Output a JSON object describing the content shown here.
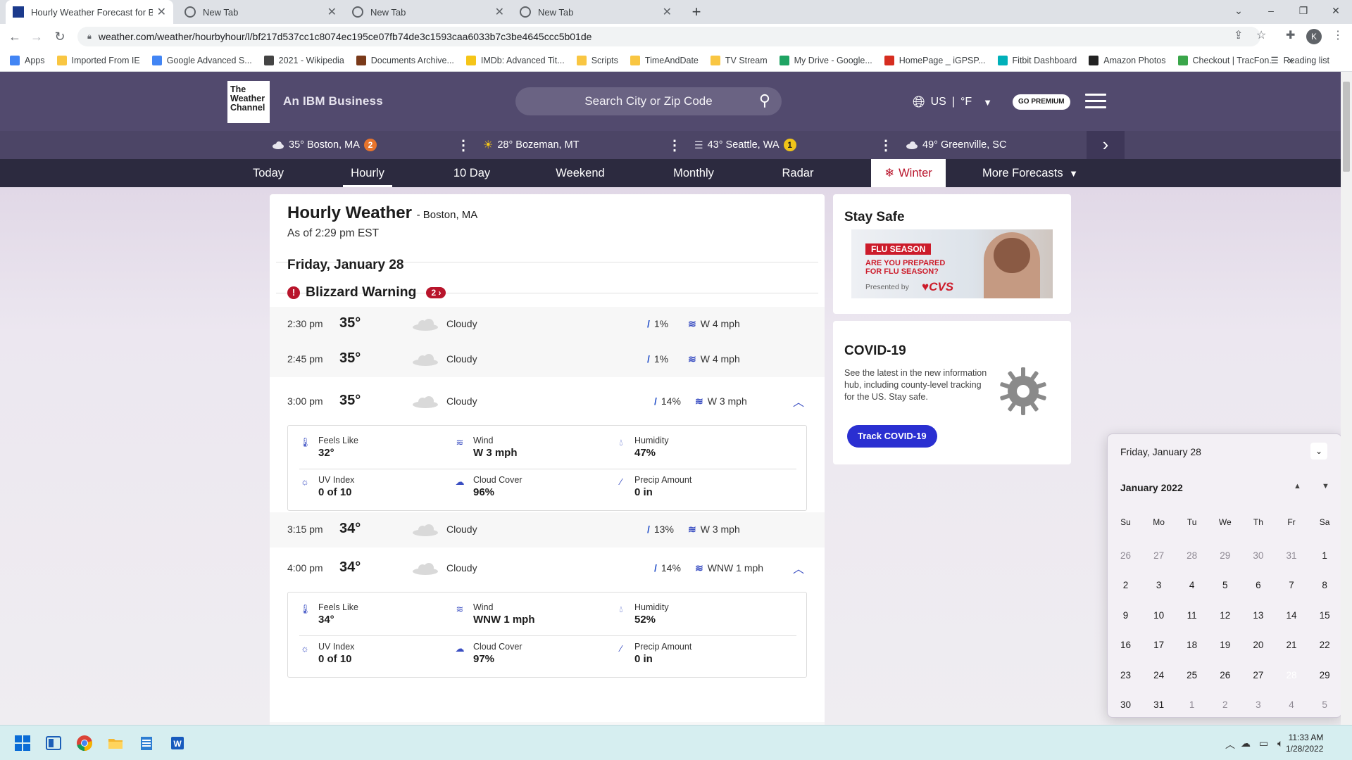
{
  "browser": {
    "tabs": [
      {
        "title": "Hourly Weather Forecast for Bos",
        "active": true
      },
      {
        "title": "New Tab",
        "active": false
      },
      {
        "title": "New Tab",
        "active": false
      },
      {
        "title": "New Tab",
        "active": false
      }
    ],
    "url": "weather.com/weather/hourbyhour/l/bf217d537cc1c8074ec195ce07fb74de3c1593caa6033b7c3be4645ccc5b01de",
    "bookmarks": [
      {
        "label": "Apps",
        "icon": "apps-grid-icon",
        "color": "#4285f4"
      },
      {
        "label": "Imported From IE",
        "icon": "folder-icon",
        "color": "#f9c642"
      },
      {
        "label": "Google Advanced S...",
        "icon": "google-icon",
        "color": "#4285f4"
      },
      {
        "label": "2021 - Wikipedia",
        "icon": "wikipedia-icon",
        "color": "#444444"
      },
      {
        "label": "Documents Archive...",
        "icon": "document-archive-icon",
        "color": "#7a3a1a"
      },
      {
        "label": "IMDb: Advanced Tit...",
        "icon": "imdb-icon",
        "color": "#f5c518"
      },
      {
        "label": "Scripts",
        "icon": "folder-icon",
        "color": "#f9c642"
      },
      {
        "label": "TimeAndDate",
        "icon": "folder-icon",
        "color": "#f9c642"
      },
      {
        "label": "TV Stream",
        "icon": "folder-icon",
        "color": "#f9c642"
      },
      {
        "label": "My Drive - Google...",
        "icon": "google-drive-icon",
        "color": "#1fa463"
      },
      {
        "label": "HomePage _ iGPSP...",
        "icon": "igps-icon",
        "color": "#d62d20"
      },
      {
        "label": "Fitbit Dashboard",
        "icon": "fitbit-icon",
        "color": "#00b0b9"
      },
      {
        "label": "Amazon Photos",
        "icon": "amazon-icon",
        "color": "#222222"
      },
      {
        "label": "Checkout | TracFon...",
        "icon": "tracfone-icon",
        "color": "#3aa64a"
      }
    ],
    "bookmarks_more": "»",
    "reading_list": "Reading list",
    "profile_initial": "K"
  },
  "site": {
    "logo_lines": [
      "The",
      "Weather",
      "Channel"
    ],
    "tagline": "An IBM Business",
    "search_placeholder": "Search City or Zip Code",
    "region": "US",
    "unit": "°F",
    "premium": "GO PREMIUM",
    "locations": [
      {
        "text": "35° Boston, MA",
        "icon": "cloud-icon",
        "badge": "2",
        "badge_color": "#e8742c"
      },
      {
        "text": "28° Bozeman, MT",
        "icon": "sun-icon",
        "badge": "",
        "badge_color": ""
      },
      {
        "text": "43° Seattle, WA",
        "icon": "fog-icon",
        "badge": "1",
        "badge_color": "#f0c419"
      },
      {
        "text": "49° Greenville, SC",
        "icon": "cloud-icon",
        "badge": "",
        "badge_color": ""
      }
    ],
    "nav": [
      "Today",
      "Hourly",
      "10 Day",
      "Weekend",
      "Monthly",
      "Radar",
      "Winter",
      "More Forecasts"
    ],
    "nav_selected": "Hourly"
  },
  "main": {
    "title": "Hourly Weather",
    "location": "- Boston, MA",
    "as_of": "As of 2:29 pm EST",
    "day": "Friday, January 28",
    "warning": "Blizzard Warning",
    "warning_count": "2",
    "rows": [
      {
        "time": "2:30 pm",
        "temp": "35°",
        "cond": "Cloudy",
        "precip": "1%",
        "wind": "W 4 mph"
      },
      {
        "time": "2:45 pm",
        "temp": "35°",
        "cond": "Cloudy",
        "precip": "1%",
        "wind": "W 4 mph"
      },
      {
        "time": "3:00 pm",
        "temp": "35°",
        "cond": "Cloudy",
        "precip": "14%",
        "wind": "W 3 mph"
      },
      {
        "time": "3:15 pm",
        "temp": "34°",
        "cond": "Cloudy",
        "precip": "13%",
        "wind": "W 3 mph"
      },
      {
        "time": "4:00 pm",
        "temp": "34°",
        "cond": "Cloudy",
        "precip": "14%",
        "wind": "WNW 1 mph"
      }
    ],
    "details": [
      {
        "feels_label": "Feels Like",
        "feels": "32°",
        "wind_label": "Wind",
        "wind": "W 3 mph",
        "humidity_label": "Humidity",
        "humidity": "47%",
        "uv_label": "UV Index",
        "uv": "0 of 10",
        "cloud_label": "Cloud Cover",
        "cloud": "96%",
        "precip_label": "Precip Amount",
        "precip": "0 in"
      },
      {
        "feels_label": "Feels Like",
        "feels": "34°",
        "wind_label": "Wind",
        "wind": "WNW 1 mph",
        "humidity_label": "Humidity",
        "humidity": "52%",
        "uv_label": "UV Index",
        "uv": "0 of 10",
        "cloud_label": "Cloud Cover",
        "cloud": "97%",
        "precip_label": "Precip Amount",
        "precip": "0 in"
      }
    ]
  },
  "side": {
    "stay_safe": "Stay Safe",
    "flu_tag": "FLU SEASON",
    "flu_q1": "ARE YOU PREPARED",
    "flu_q2": "FOR FLU SEASON?",
    "presented": "Presented by",
    "cvs": "CVS",
    "covid_title": "COVID-19",
    "covid_text": "See the latest in the new information hub, including county-level tracking for the US. Stay safe.",
    "covid_btn": "Track COVID-19"
  },
  "calendar": {
    "header": "Friday, January 28",
    "month": "January 2022",
    "weekdays": [
      "Su",
      "Mo",
      "Tu",
      "We",
      "Th",
      "Fr",
      "Sa"
    ],
    "weeks": [
      [
        "26",
        "27",
        "28",
        "29",
        "30",
        "31",
        "1"
      ],
      [
        "2",
        "3",
        "4",
        "5",
        "6",
        "7",
        "8"
      ],
      [
        "9",
        "10",
        "11",
        "12",
        "13",
        "14",
        "15"
      ],
      [
        "16",
        "17",
        "18",
        "19",
        "20",
        "21",
        "22"
      ],
      [
        "23",
        "24",
        "25",
        "26",
        "27",
        "28",
        "29"
      ],
      [
        "30",
        "31",
        "1",
        "2",
        "3",
        "4",
        "5"
      ]
    ],
    "selected": "28"
  },
  "taskbar": {
    "time": "11:33 AM",
    "date": "1/28/2022"
  }
}
